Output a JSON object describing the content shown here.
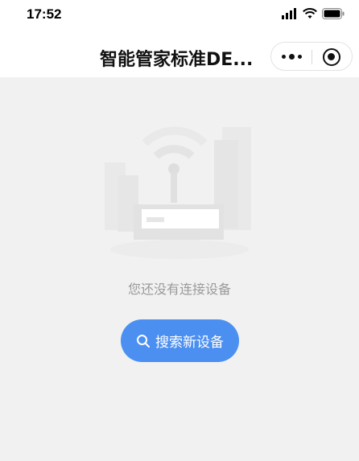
{
  "status_bar": {
    "time": "17:52"
  },
  "nav": {
    "title": "智能管家标准DE..."
  },
  "empty_state": {
    "message": "您还没有连接设备",
    "button_label": "搜索新设备"
  },
  "colors": {
    "button": "#4b8ff1",
    "background": "#f1f1f1",
    "muted_text": "#9a9a9a"
  },
  "icons": {
    "signal": "cellular-signal-icon",
    "wifi": "wifi-icon",
    "battery": "battery-icon",
    "more": "more-dots-icon",
    "close": "capsule-close-icon",
    "search": "search-icon"
  }
}
